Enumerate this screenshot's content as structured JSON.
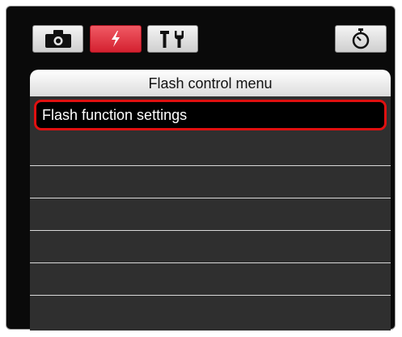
{
  "tabs": [
    {
      "icon": "camera-icon",
      "active": false
    },
    {
      "icon": "flash-icon",
      "active": true
    },
    {
      "icon": "tools-icon",
      "active": false
    }
  ],
  "timer_tab": {
    "icon": "timer-icon"
  },
  "menu": {
    "title": "Flash control menu",
    "items": [
      "Flash function settings",
      "",
      "",
      "",
      "",
      ""
    ],
    "selected_index": 0
  },
  "colors": {
    "active_tab": "#d42130",
    "selection_border": "#e01010",
    "list_background": "#2f2f2f",
    "screen_background": "#0a0a0a"
  }
}
